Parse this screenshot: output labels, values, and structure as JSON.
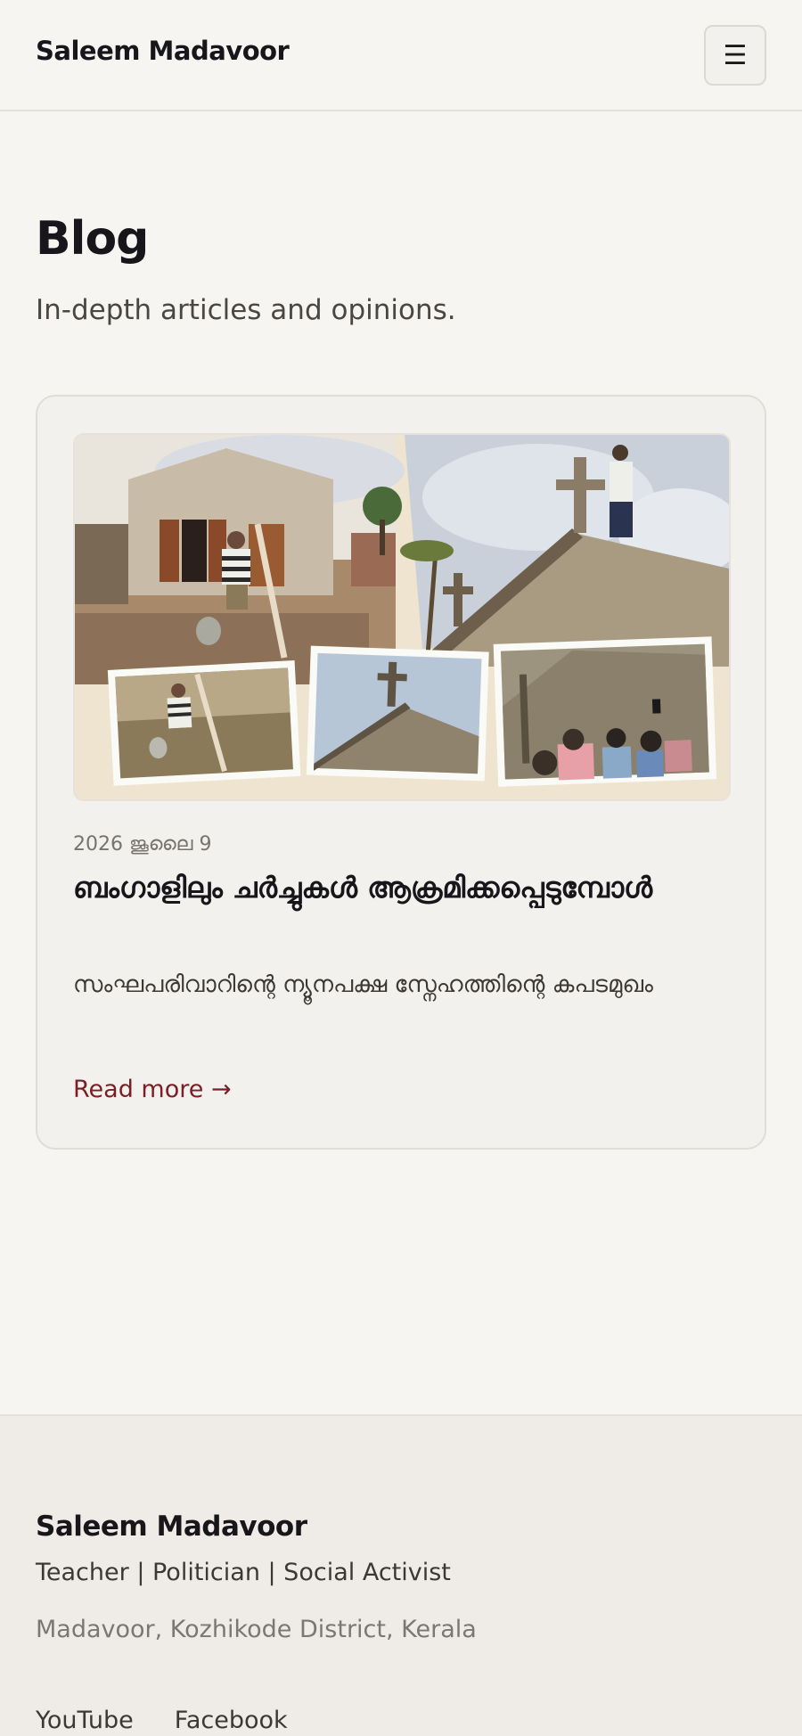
{
  "header": {
    "brand": "Saleem Madavoor",
    "menu_icon": "hamburger-menu-icon",
    "menu_glyph": "☰"
  },
  "page": {
    "title": "Blog",
    "subtitle": "In-depth articles and opinions."
  },
  "posts": [
    {
      "date": "2026 ജൂലൈ 9",
      "title": "ബംഗാളിലും ചർച്ചുകൾ ആക്രമിക്കപ്പെടുമ്പോൾ",
      "excerpt": "സംഘപരിവാറിന്റെ ന്യൂനപക്ഷ സ്നേഹത്തിന്റെ കപടമുഖം",
      "read_more": "Read more →"
    }
  ],
  "footer": {
    "brand": "Saleem Madavoor",
    "tagline": "Teacher | Politician | Social Activist",
    "location": "Madavoor, Kozhikode District, Kerala",
    "links": [
      "YouTube",
      "Facebook"
    ]
  },
  "colors": {
    "background": "#f7f5f2",
    "accent_link": "#7a1f25",
    "footer_background": "#efebe6"
  }
}
